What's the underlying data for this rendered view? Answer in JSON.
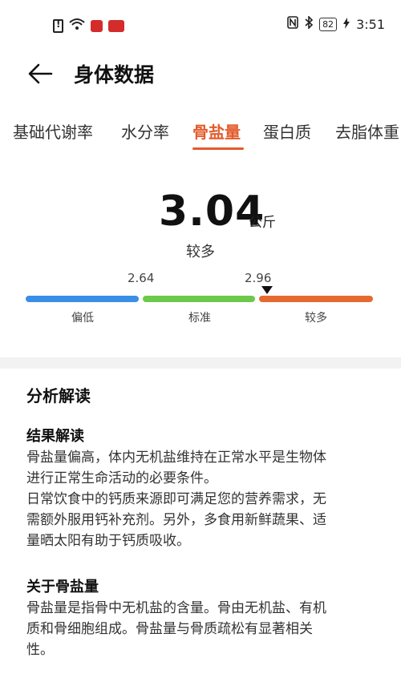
{
  "status_bar": {
    "battery": "82",
    "time": "3:51"
  },
  "header": {
    "title": "身体数据"
  },
  "tabs": [
    {
      "label": "基础代谢率",
      "active": false
    },
    {
      "label": "水分率",
      "active": false
    },
    {
      "label": "骨盐量",
      "active": true
    },
    {
      "label": "蛋白质",
      "active": false
    },
    {
      "label": "去脂体重",
      "active": false
    }
  ],
  "measurement": {
    "value": "3.04",
    "unit": "公斤",
    "level": "较多",
    "thresholds": [
      "2.64",
      "2.96"
    ],
    "segments": [
      "偏低",
      "标准",
      "较多"
    ],
    "colors": {
      "low": "#3a8ee6",
      "normal": "#6cc94a",
      "high": "#e56a30",
      "accent": "#e35b2a"
    }
  },
  "analysis": {
    "title": "分析解读",
    "result_heading": "结果解读",
    "result_lines": [
      "骨盐量偏高，体内无机盐维持在正常水平是生物体",
      "进行正常生命活动的必要条件。",
      "日常饮食中的钙质来源即可满足您的营养需求，无",
      "需额外服用钙补充剂。另外，多食用新鲜蔬果、适",
      "量晒太阳有助于钙质吸收。"
    ],
    "about_heading": "关于骨盐量",
    "about_lines": [
      "骨盐量是指骨中无机盐的含量。骨由无机盐、有机",
      "质和骨细胞组成。骨盐量与骨质疏松有显著相关",
      "性。"
    ]
  }
}
